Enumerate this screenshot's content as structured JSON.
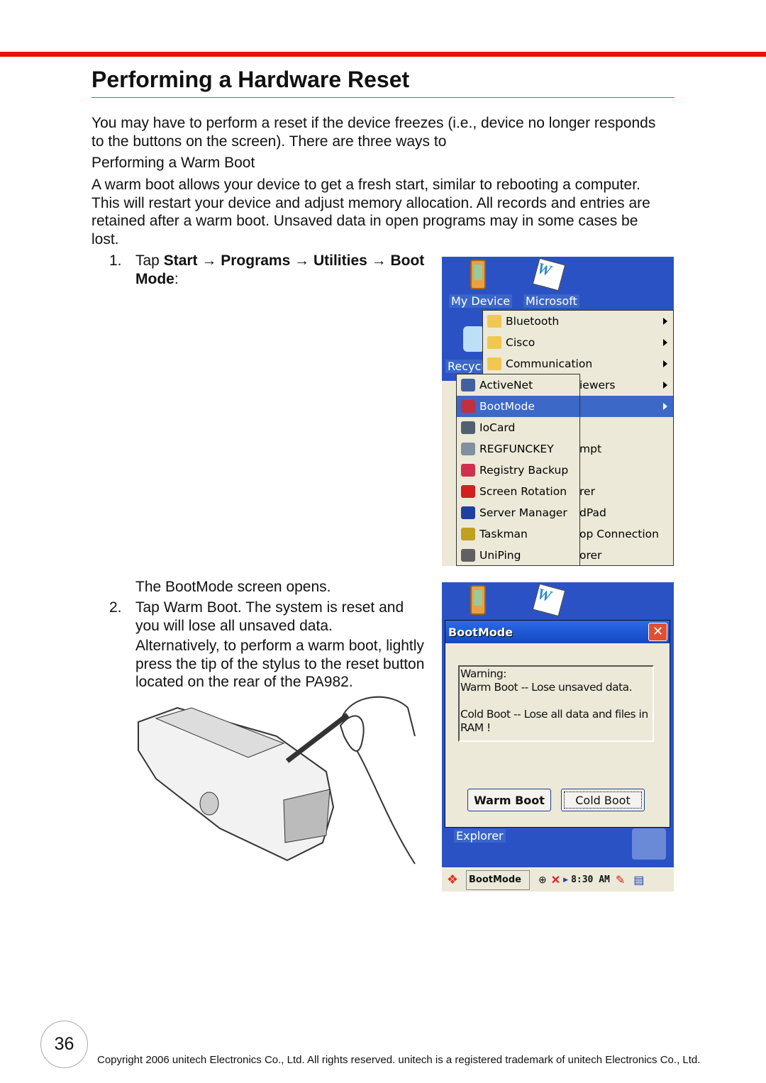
{
  "title": "Performing a Hardware Reset",
  "intro": [
    "You may have to perform a reset if the device freezes (i.e., device no longer responds",
    "to the buttons on the screen). There are three ways to"
  ],
  "subheading": "Performing a Warm Boot",
  "para": [
    "A warm boot allows your device to get a fresh start, similar to rebooting a computer.",
    "This will restart your device and adjust memory allocation. All records and entries are",
    "retained after a warm boot. Unsaved data in open programs may in some cases be",
    "lost."
  ],
  "step1": {
    "num": "1.",
    "tap": "Tap ",
    "start": "Start",
    "arrow": " → ",
    "programs": "Programs",
    "utilities": "Utilities",
    "boot": "Boot",
    "mode": "Mode",
    "colon": ":"
  },
  "screen1": {
    "desktop_icons": [
      "My Device",
      "Microsoft",
      "Recycl"
    ],
    "programs_menu": [
      {
        "label": "Bluetooth",
        "submenu": true
      },
      {
        "label": "Cisco",
        "submenu": true
      },
      {
        "label": "Communication",
        "submenu": true
      },
      {
        "label": "iewers",
        "submenu": true
      }
    ],
    "programs_partial": [
      "mpt",
      "rer",
      "dPad",
      "op Connection",
      "orer"
    ],
    "utilities_menu": [
      {
        "label": "ActiveNet",
        "icon": "network-icon"
      },
      {
        "label": "BootMode",
        "icon": "bootmode-icon",
        "selected": true
      },
      {
        "label": "IoCard",
        "icon": "card-icon"
      },
      {
        "label": "REGFUNCKEY",
        "icon": "keyboard-icon"
      },
      {
        "label": "Registry Backup",
        "icon": "backup-icon"
      },
      {
        "label": "Screen Rotation",
        "icon": "rotation-icon"
      },
      {
        "label": "Server Manager",
        "icon": "computer-icon"
      },
      {
        "label": "Taskman",
        "icon": "traffic-light-icon"
      },
      {
        "label": "UniPing",
        "icon": "ping-icon"
      }
    ]
  },
  "step2": {
    "opens": "The BootMode screen opens.",
    "num": "2.",
    "lines": [
      "Tap Warm Boot. The system is reset and",
      "you will lose all unsaved data."
    ],
    "alt": [
      "Alternatively, to perform a warm boot, lightly",
      "press the tip of the stylus to the reset button",
      "located on the rear of the PA982."
    ]
  },
  "screen2": {
    "dialog_title": "BootMode",
    "warning": [
      "Warning:",
      "Warm Boot -- Lose unsaved data.",
      "",
      "Cold Boot -- Lose all data and files in",
      "RAM !"
    ],
    "warm_boot": "Warm Boot",
    "cold_boot": "Cold Boot",
    "desktop_label": "Explorer",
    "taskbar": {
      "task": "BootMode",
      "time": "8:30 AM"
    }
  },
  "page_number": "36",
  "footer": "Copyright 2006 unitech Electronics Co., Ltd. All rights reserved. unitech is a registered trademark of unitech Electronics Co., Ltd.",
  "colors": {
    "accent": "#e8100c",
    "desktop": "#2a52c4",
    "highlight": "#3c68c8",
    "menu": "#ece9d8"
  }
}
